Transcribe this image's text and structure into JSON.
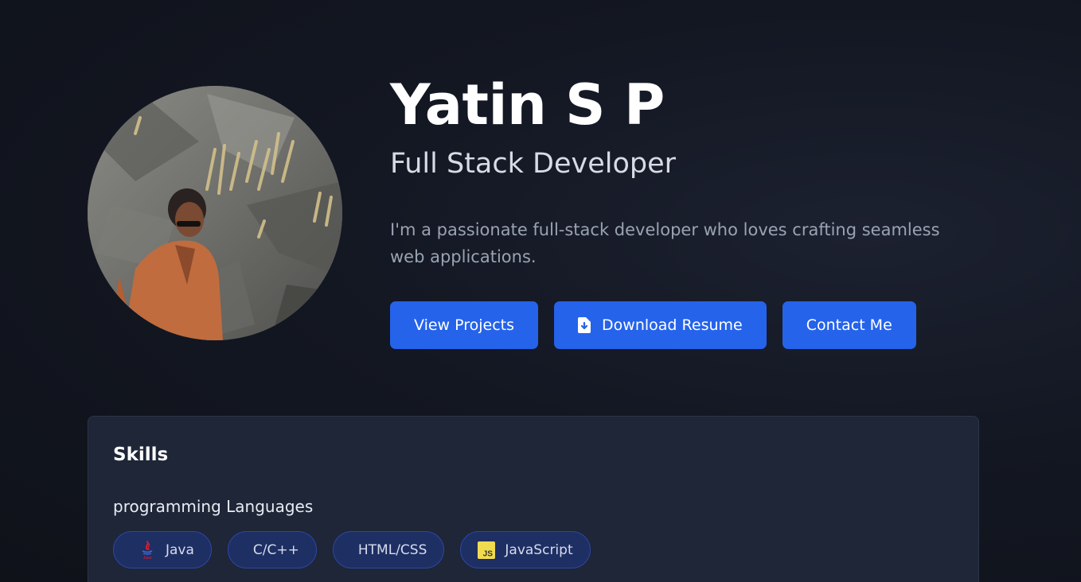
{
  "profile": {
    "name": "Yatin S P",
    "role": "Full Stack Developer",
    "bio": "I'm a passionate full-stack developer who loves crafting seamless web applications."
  },
  "actions": {
    "view_projects": "View Projects",
    "download_resume": "Download Resume",
    "contact_me": "Contact Me"
  },
  "skills": {
    "title": "Skills",
    "category": "programming Languages",
    "items": [
      {
        "label": "Java",
        "icon": "java-icon"
      },
      {
        "label": "C/C++",
        "icon": ""
      },
      {
        "label": "HTML/CSS",
        "icon": ""
      },
      {
        "label": "JavaScript",
        "icon": "javascript-icon"
      }
    ]
  },
  "colors": {
    "accent": "#2563eb",
    "card": "#1e2637",
    "chip": "#1e2f63"
  }
}
